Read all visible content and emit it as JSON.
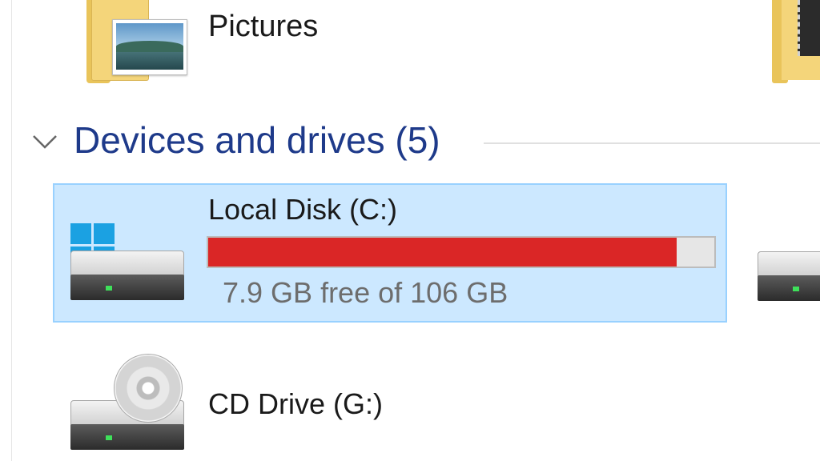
{
  "folders": {
    "pictures": {
      "label": "Pictures",
      "icon": "pictures-folder-icon"
    }
  },
  "section": {
    "title": "Devices and drives (5)",
    "collapsed": false
  },
  "drives": {
    "c": {
      "label": "Local Disk (C:)",
      "usage_text": "7.9 GB free of 106 GB",
      "used_fraction": 0.925,
      "bar_color": "#da2626",
      "icon": "windows-drive-icon",
      "selected": true
    },
    "g": {
      "label": "CD Drive (G:)",
      "icon": "cd-drive-icon"
    }
  },
  "colors": {
    "selection_bg": "#cce8ff",
    "selection_border": "#99d1ff",
    "section_title": "#1e3a8a",
    "windows_logo": "#1ba1e2"
  }
}
